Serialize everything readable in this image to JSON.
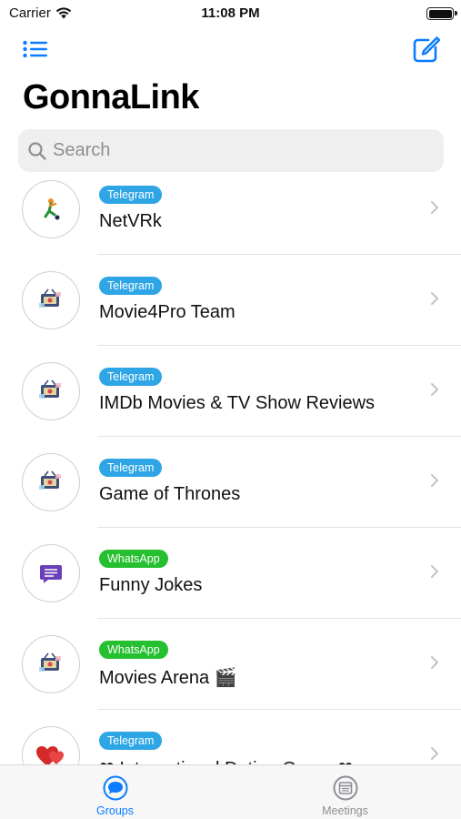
{
  "status_bar": {
    "carrier": "Carrier",
    "time": "11:08 PM"
  },
  "nav": {
    "left_icon": "list-icon",
    "right_icon": "compose-icon"
  },
  "app_title": "GonnaLink",
  "search": {
    "placeholder": "Search",
    "value": ""
  },
  "colors": {
    "accent": "#0a7cff",
    "telegram": "#2ea6e6",
    "whatsapp": "#25c02f",
    "tab_inactive": "#8e8e93"
  },
  "groups": [
    {
      "platform": "Telegram",
      "name": "NetVRk",
      "avatar_icon": "soccer-player-icon"
    },
    {
      "platform": "Telegram",
      "name": "Movie4Pro Team",
      "avatar_icon": "movie-tv-icon"
    },
    {
      "platform": "Telegram",
      "name": "IMDb Movies & TV Show Reviews",
      "avatar_icon": "movie-tv-icon"
    },
    {
      "platform": "Telegram",
      "name": "Game of Thrones",
      "avatar_icon": "movie-tv-icon"
    },
    {
      "platform": "WhatsApp",
      "name": "Funny Jokes",
      "avatar_icon": "chat-bubble-icon"
    },
    {
      "platform": "WhatsApp",
      "name": "Movies Arena 🎬",
      "avatar_icon": "movie-tv-icon"
    },
    {
      "platform": "Telegram",
      "name": "❤ International Dating Group ❤",
      "avatar_icon": "hearts-icon"
    }
  ],
  "tabs": [
    {
      "label": "Groups",
      "icon": "groups-chat-icon",
      "active": true
    },
    {
      "label": "Meetings",
      "icon": "meetings-calendar-icon",
      "active": false
    }
  ]
}
